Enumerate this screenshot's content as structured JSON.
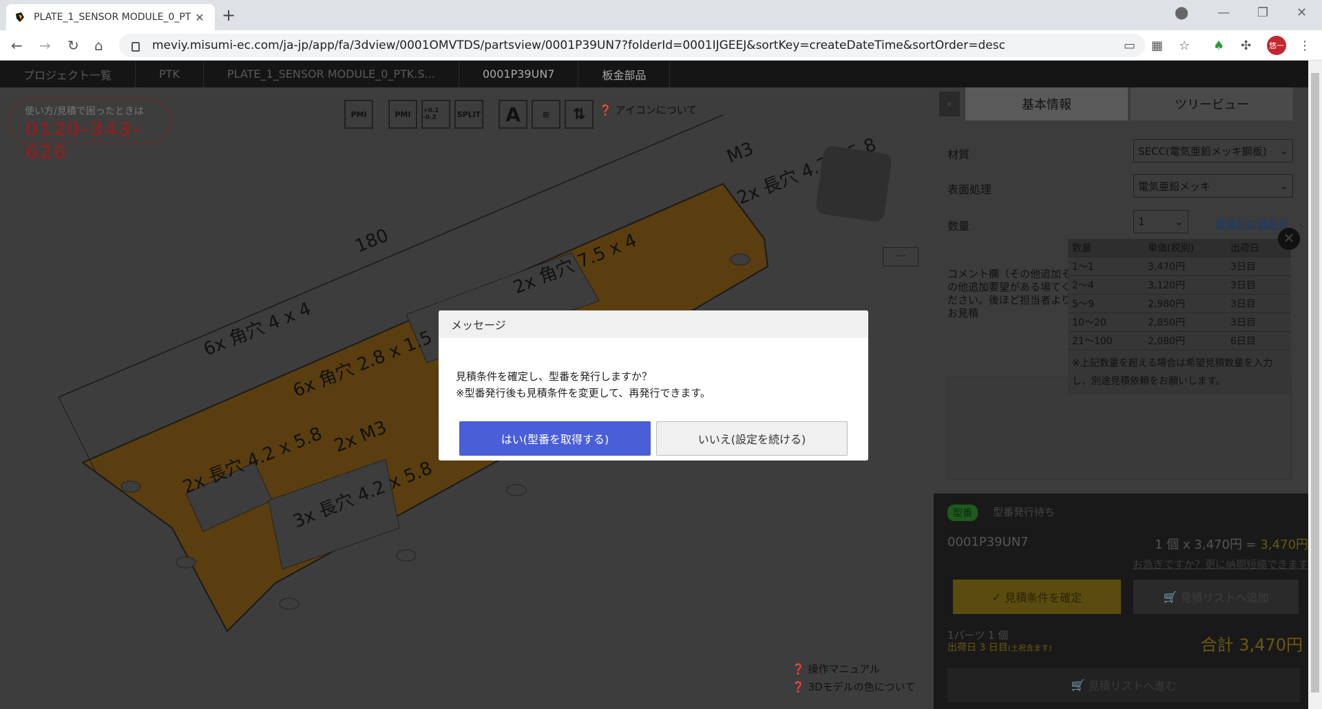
{
  "browser": {
    "tab_title": "PLATE_1_SENSOR MODULE_0_PT",
    "url": "meviy.misumi-ec.com/ja-jp/app/fa/3dview/0001OMVTDS/partsview/0001P39UN7?folderId=0001IJGEEJ&sortKey=createDateTime&sortOrder=desc",
    "avatar_text": "悠一"
  },
  "breadcrumbs": [
    "プロジェクト一覧",
    "PTK",
    "PLATE_1_SENSOR MODULE_0_PTK.S...",
    "0001P39UN7",
    "板金部品"
  ],
  "hotline": {
    "caption": "使い方/見積で困ったときは",
    "phone": "0120-343-626"
  },
  "viewer_tools": {
    "pmi": "PMI",
    "pmi_plus": "PMI",
    "tolerance": "+0.1 -0.2",
    "split": "SPLIT",
    "icon_note": "アイコンについて",
    "more": "···",
    "manual": "操作マニュアル",
    "color_note": "3Dモデルの色について"
  },
  "drawing_labels": [
    "180",
    "6x 角穴 4 x 4",
    "2x 角穴 7.5 x 4",
    "M3",
    "2x 長穴 4.2 x 5.8",
    "6x 角穴 2.8 x 1.5",
    "2x 長穴 4.2 x 5.8",
    "2x M3",
    "3x 長穴 4.2 x 5.8"
  ],
  "panel": {
    "tab_basic": "基本情報",
    "tab_tree": "ツリービュー",
    "material_label": "材質",
    "material_value": "SECC(電気亜鉛メッキ鋼板)",
    "surface_label": "表面処理",
    "surface_value": "電気亜鉛メッキ",
    "qty_label": "数量",
    "qty_value": "1",
    "price_link": "数量別の価格表",
    "price_table": {
      "headers": [
        "数量",
        "単価(税別)",
        "出荷日"
      ],
      "rows": [
        [
          "1〜1",
          "3,470円",
          "3日目"
        ],
        [
          "2〜4",
          "3,120円",
          "3日目"
        ],
        [
          "5〜9",
          "2,980円",
          "3日目"
        ],
        [
          "10〜20",
          "2,850円",
          "3日目"
        ],
        [
          "21〜100",
          "2,080円",
          "6日目"
        ]
      ],
      "note": "※上記数量を超える場合は希望見積数量を入力し、別途見積依頼をお願いします。"
    },
    "comment": "コメント欄（その他追加その他追加要望がある場てください。後ほど担当者よりお見積",
    "badge": "型番",
    "status": "型番発行待ち",
    "part_no": "0001P39UN7",
    "price_line": "1 個 x 3,470円 =",
    "price_total_line": "3,470円",
    "hurry": "お急ぎですか？更に納期短縮できます",
    "confirm_btn": "見積条件を確定",
    "addlist_btn": "見積リストへ追加",
    "parts_summary": "1パーツ 1 個",
    "ship_day": "出荷日 3 日目",
    "ship_note": "(土祝含ます)",
    "total_label": "合計",
    "total_value": "3,470円",
    "goto_btn": "見積リストへ進む"
  },
  "modal": {
    "title": "メッセージ",
    "line1": "見積条件を確定し、型番を発行しますか？",
    "line2": "※型番発行後も見積条件を変更して、再発行できます。",
    "yes": "はい(型番を取得する)",
    "no": "いいえ(設定を続ける)"
  }
}
